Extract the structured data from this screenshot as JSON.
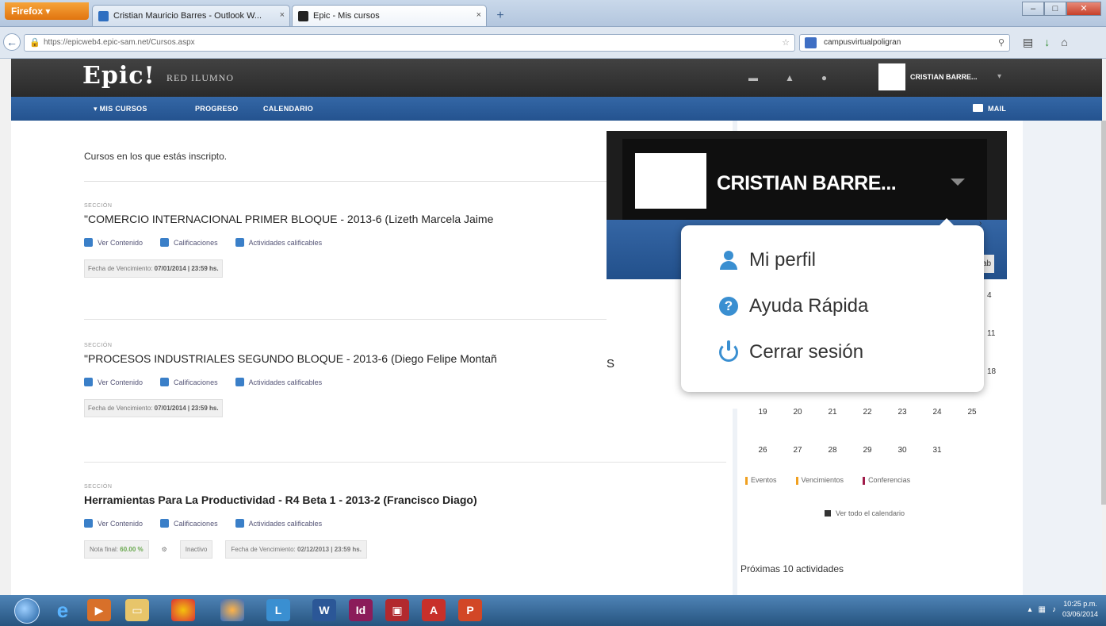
{
  "browser": {
    "firefox_label": "Firefox ▾",
    "tabs": [
      {
        "label": "Cristian Mauricio Barres - Outlook W...",
        "close": "×"
      },
      {
        "label": "Epic - Mis cursos",
        "close": "×"
      }
    ],
    "new_tab": "+",
    "url": "https://epicweb4.epic-sam.net/Cursos.aspx",
    "search_text": "campusvirtualpoligran"
  },
  "site": {
    "logo": "Epic!",
    "network_logo": "RED ILUMNO",
    "user_name": "CRISTIAN BARRE...",
    "nav": [
      "▾ MIS CURSOS",
      "PROGRESO",
      "CALENDARIO"
    ],
    "mail": "MAIL"
  },
  "main": {
    "intro": "Cursos en los que estás inscripto.",
    "link_labels": [
      "Ver Contenido",
      "Calificaciones",
      "Actividades calificables"
    ],
    "courses": [
      {
        "section": "SECCIÓN",
        "title": "\"COMERCIO INTERNACIONAL PRIMER BLOQUE - 2013-6 (Lizeth Marcela Jaime",
        "date_label": "Fecha de Vencimiento:",
        "date_value": "07/01/2014 | 23:59 hs."
      },
      {
        "section": "SECCIÓN",
        "title": "\"PROCESOS INDUSTRIALES SEGUNDO BLOQUE - 2013-6 (Diego Felipe Montañ",
        "date_label": "Fecha de Vencimiento:",
        "date_value": "07/01/2014 | 23:59 hs."
      },
      {
        "section": "SECCIÓN",
        "title": "Herramientas Para La Productividad - R4 Beta 1 - 2013-2 (Francisco Diago)",
        "grade_label": "Nota final:",
        "grade_value": "60.00 %",
        "grade_status": "Inactivo",
        "date_label": "Fecha de Vencimiento:",
        "date_value": "02/12/2013 | 23:59 hs."
      }
    ]
  },
  "calendar": {
    "right_numbers": [
      "4",
      "11",
      "18"
    ],
    "week4": [
      "19",
      "20",
      "21",
      "22",
      "23",
      "24",
      "25"
    ],
    "week5": [
      "26",
      "27",
      "28",
      "29",
      "30",
      "31"
    ],
    "legend": [
      "Eventos",
      "Vencimientos",
      "Conferencias"
    ],
    "view_all": "Ver todo el calendario",
    "upcoming": "Próximas 10 actividades"
  },
  "zoom": {
    "user_name": "CRISTIAN BARRE...",
    "bleed_text": "S",
    "cal_fragments": [
      "›",
      "ab",
      "4",
      "11",
      "18"
    ],
    "menu": [
      "Mi perfil",
      "Ayuda Rápida",
      "Cerrar sesión"
    ]
  },
  "taskbar": {
    "clock_time": "10:25 p.m.",
    "clock_date": "03/06/2014"
  },
  "colors": {
    "nav_blue": "#2a5b9a",
    "header_dark": "#333333",
    "icon_blue": "#3a8fd1",
    "grade_green": "#6aa84f"
  }
}
